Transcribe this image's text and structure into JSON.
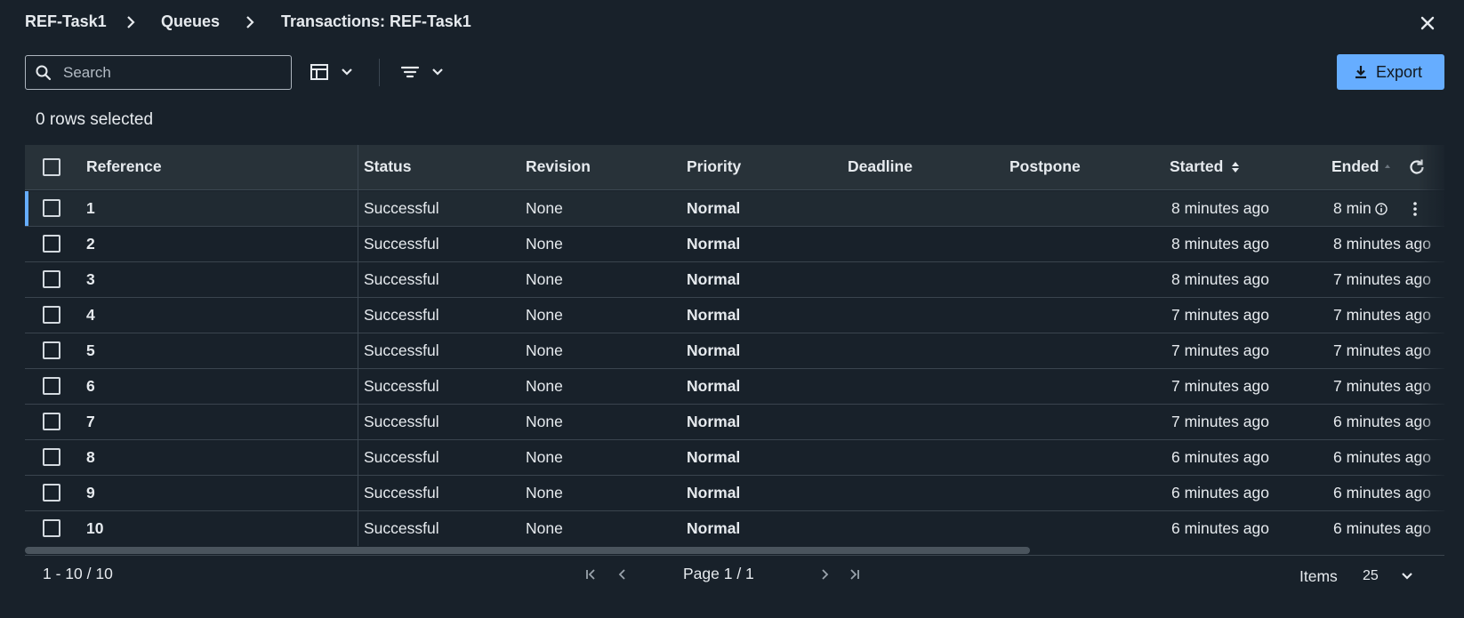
{
  "breadcrumb": {
    "items": [
      "REF-Task1",
      "Queues",
      "Transactions: REF-Task1"
    ]
  },
  "icons": {
    "close": "close-icon",
    "chevron_right": "chevron-right-icon",
    "search": "search-icon",
    "columns": "table-columns-icon",
    "filter": "filter-icon",
    "export": "download-icon",
    "refresh": "refresh-icon",
    "info": "info-icon",
    "more": "more-vertical-icon"
  },
  "toolbar": {
    "search_placeholder": "Search",
    "export_label": "Export"
  },
  "selection": {
    "text": "0 rows selected"
  },
  "table": {
    "columns": [
      "Reference",
      "Status",
      "Revision",
      "Priority",
      "Deadline",
      "Postpone",
      "Started",
      "Ended"
    ],
    "rows": [
      {
        "reference": "1",
        "status": "Successful",
        "revision": "None",
        "priority": "Normal",
        "deadline": "",
        "postpone": "",
        "started": "8 minutes ago",
        "ended": "8 min"
      },
      {
        "reference": "2",
        "status": "Successful",
        "revision": "None",
        "priority": "Normal",
        "deadline": "",
        "postpone": "",
        "started": "8 minutes ago",
        "ended": "8 minutes ago"
      },
      {
        "reference": "3",
        "status": "Successful",
        "revision": "None",
        "priority": "Normal",
        "deadline": "",
        "postpone": "",
        "started": "8 minutes ago",
        "ended": "7 minutes ago"
      },
      {
        "reference": "4",
        "status": "Successful",
        "revision": "None",
        "priority": "Normal",
        "deadline": "",
        "postpone": "",
        "started": "7 minutes ago",
        "ended": "7 minutes ago"
      },
      {
        "reference": "5",
        "status": "Successful",
        "revision": "None",
        "priority": "Normal",
        "deadline": "",
        "postpone": "",
        "started": "7 minutes ago",
        "ended": "7 minutes ago"
      },
      {
        "reference": "6",
        "status": "Successful",
        "revision": "None",
        "priority": "Normal",
        "deadline": "",
        "postpone": "",
        "started": "7 minutes ago",
        "ended": "7 minutes ago"
      },
      {
        "reference": "7",
        "status": "Successful",
        "revision": "None",
        "priority": "Normal",
        "deadline": "",
        "postpone": "",
        "started": "7 minutes ago",
        "ended": "6 minutes ago"
      },
      {
        "reference": "8",
        "status": "Successful",
        "revision": "None",
        "priority": "Normal",
        "deadline": "",
        "postpone": "",
        "started": "6 minutes ago",
        "ended": "6 minutes ago"
      },
      {
        "reference": "9",
        "status": "Successful",
        "revision": "None",
        "priority": "Normal",
        "deadline": "",
        "postpone": "",
        "started": "6 minutes ago",
        "ended": "6 minutes ago"
      },
      {
        "reference": "10",
        "status": "Successful",
        "revision": "None",
        "priority": "Normal",
        "deadline": "",
        "postpone": "",
        "started": "6 minutes ago",
        "ended": "6 minutes ago"
      }
    ]
  },
  "pagination": {
    "range": "1 - 10 / 10",
    "page": "Page 1 / 1",
    "items_label": "Items",
    "items_value": "25"
  },
  "colors": {
    "background": "#18212a",
    "header_bg": "#283239",
    "accent": "#66adff",
    "text": "#e6eaee"
  }
}
